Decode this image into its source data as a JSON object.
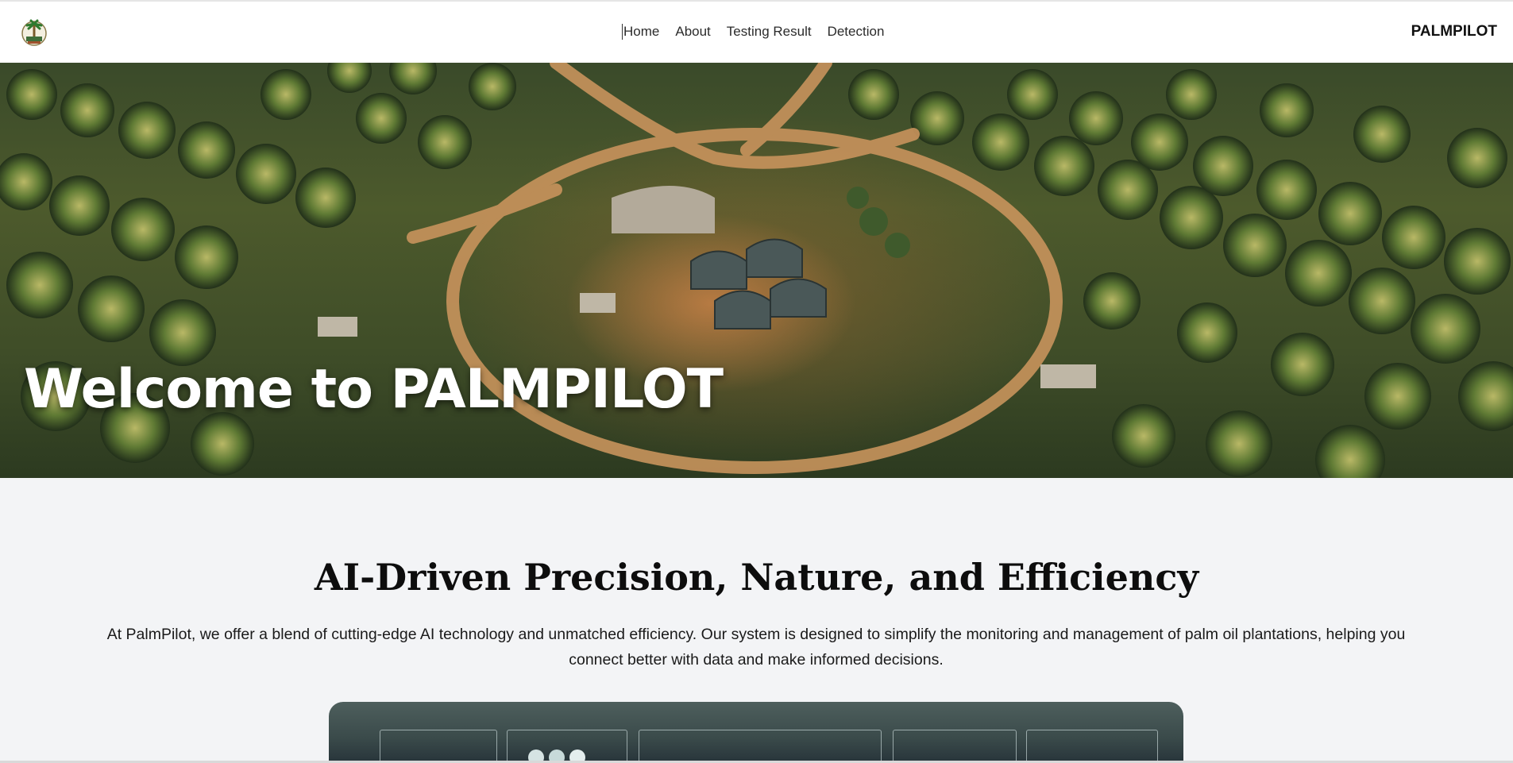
{
  "header": {
    "logo_icon": "palm-tree-logo-icon",
    "nav": [
      {
        "label": "Home",
        "active": true
      },
      {
        "label": "About"
      },
      {
        "label": "Testing Result"
      },
      {
        "label": "Detection"
      }
    ],
    "brand": "PALMPILOT"
  },
  "hero": {
    "title": "Welcome to PALMPILOT",
    "image": "aerial-palm-plantation-image"
  },
  "intro": {
    "title": "AI-Driven Precision, Nature, and Efficiency",
    "description": "At PalmPilot, we offer a blend of cutting-edge AI technology and unmatched efficiency. Our system is designed to simplify the monitoring and management of palm oil plantations, helping you connect better with data and make informed decisions."
  },
  "preview": {
    "image": "dashboard-preview-image"
  },
  "colors": {
    "background": "#f3f4f6",
    "nav_text": "#2b2b2b",
    "hero_text": "#ffffff"
  }
}
